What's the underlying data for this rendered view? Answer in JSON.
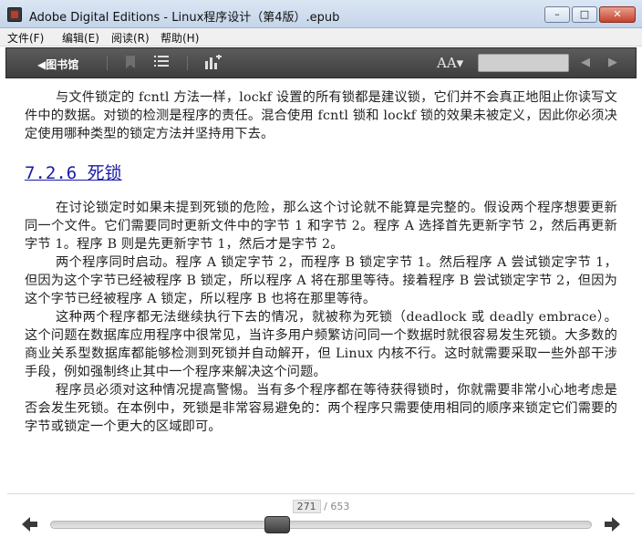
{
  "window": {
    "title": "Adobe Digital Editions - Linux程序设计（第4版）.epub",
    "controls": {
      "minimize": "–",
      "maximize": "□",
      "close": "✕"
    }
  },
  "menu": {
    "items": [
      {
        "label": "文件(F)"
      },
      {
        "label": "编辑(E)"
      },
      {
        "label": "阅读(R)"
      },
      {
        "label": "帮助(H)"
      }
    ]
  },
  "toolbar": {
    "library_label": "◀图书馆",
    "bookmark_icon": "bookmark-icon",
    "list_icon": "list-icon",
    "chart_icon": "chart-add-icon",
    "font_size_label": "AA▾",
    "search_placeholder": "",
    "colors": {
      "bar": "#4a4a4a",
      "icon": "#d9d9d9"
    }
  },
  "content": {
    "paragraph_intro": "与文件锁定的 fcntl 方法一样，lockf 设置的所有锁都是建议锁，它们并不会真正地阻止你读写文件中的数据。对锁的检测是程序的责任。混合使用 fcntl 锁和 lockf 锁的效果未被定义，因此你必须决定使用哪种类型的锁定方法并坚持用下去。",
    "heading": "7.2.6  死锁",
    "paragraphs": [
      "在讨论锁定时如果未提到死锁的危险，那么这个讨论就不能算是完整的。假设两个程序想要更新同一个文件。它们需要同时更新文件中的字节 1 和字节 2。程序 A 选择首先更新字节 2，然后再更新字节 1。程序 B 则是先更新字节 1，然后才是字节 2。",
      "两个程序同时启动。程序 A 锁定字节 2，而程序 B 锁定字节 1。然后程序 A 尝试锁定字节 1，但因为这个字节已经被程序 B 锁定，所以程序 A 将在那里等待。接着程序 B 尝试锁定字节 2，但因为这个字节已经被程序 A 锁定，所以程序 B 也将在那里等待。",
      "这种两个程序都无法继续执行下去的情况，就被称为死锁（deadlock 或 deadly embrace）。这个问题在数据库应用程序中很常见，当许多用户频繁访问同一个数据时就很容易发生死锁。大多数的商业关系型数据库都能够检测到死锁并自动解开，但 Linux 内核不行。这时就需要采取一些外部干涉手段，例如强制终止其中一个程序来解决这个问题。",
      "程序员必须对这种情况提高警惕。当有多个程序都在等待获得锁时，你就需要非常小心地考虑是否会发生死锁。在本例中，死锁是非常容易避免的：两个程序只需要使用相同的顺序来锁定它们需要的字节或锁定一个更大的区域即可。"
    ],
    "heading_color": "#1a1aa6"
  },
  "footer": {
    "page_current": "271",
    "page_total": "/ 653",
    "progress": 0.415,
    "prev_icon": "arrow-left-icon",
    "next_icon": "arrow-right-icon"
  }
}
